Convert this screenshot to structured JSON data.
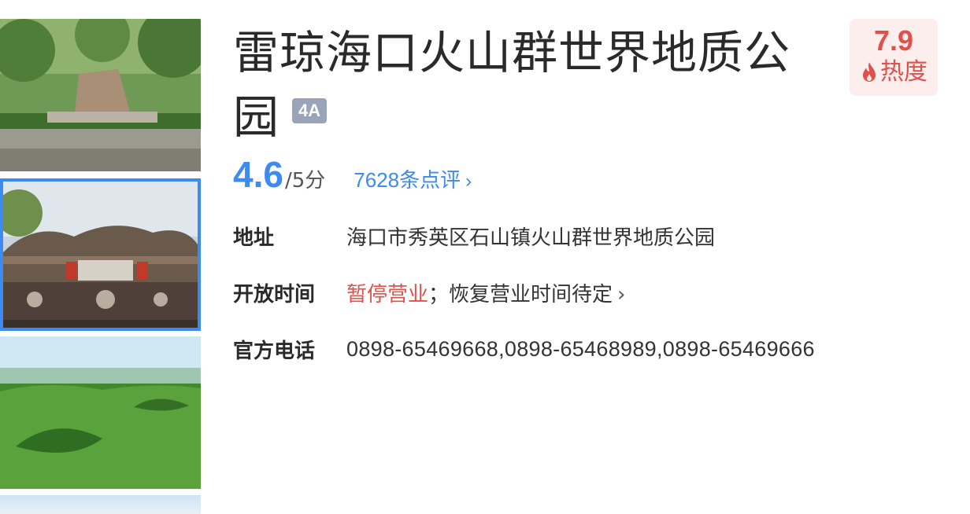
{
  "poi": {
    "title": "雷琼海口火山群世界地质公园",
    "level_badge": "4A"
  },
  "heat": {
    "value": "7.9",
    "label": "热度",
    "color": "#e0514b",
    "icon": "flame-icon"
  },
  "rating": {
    "score": "4.6",
    "suffix": "/5分",
    "reviews_label": "7628条点评",
    "reviews_chevron": "›",
    "color": "#3d8bf2"
  },
  "info": {
    "address_label": "地址",
    "address_value": "海口市秀英区石山镇火山群世界地质公园",
    "hours_label": "开放时间",
    "hours_status": "暂停营业",
    "hours_note": "；恢复营业时间待定",
    "hours_chevron": "›",
    "phone_label": "官方电话",
    "phone_value": "0898-65469668,0898-65468989,0898-65469666"
  },
  "gallery": {
    "selected_index": 1,
    "accent_color": "#3d8bf2"
  }
}
